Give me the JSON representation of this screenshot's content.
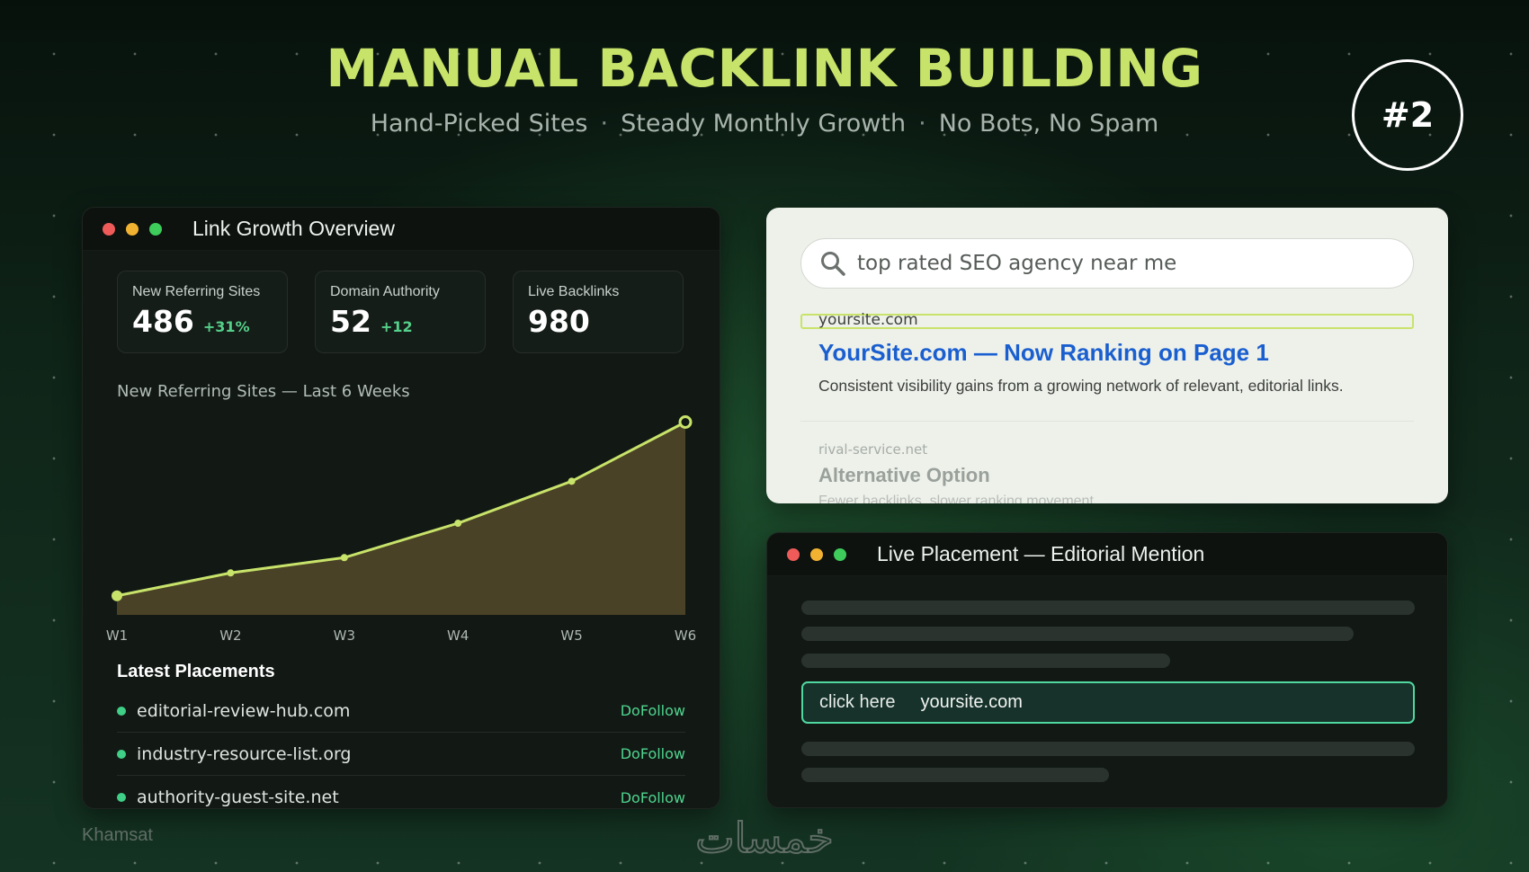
{
  "header": {
    "title": "MANUAL BACKLINK BUILDING",
    "subtitle_items": [
      "Hand-Picked Sites",
      "Steady Monthly Growth",
      "No Bots, No Spam"
    ],
    "separator": "·",
    "badge": "#2"
  },
  "left_panel": {
    "title": "Link Growth Overview",
    "stats": [
      {
        "label": "New Referring Sites",
        "value": "486",
        "delta": "+31%"
      },
      {
        "label": "Domain Authority",
        "value": "52",
        "delta": "+12"
      },
      {
        "label": "Live Backlinks",
        "value": "980",
        "delta": ""
      }
    ],
    "chart_title": "New Referring Sites — Last 6 Weeks",
    "placements_title": "Latest Placements",
    "placements": [
      {
        "domain": "editorial-review-hub.com",
        "tag": "DoFollow"
      },
      {
        "domain": "industry-resource-list.org",
        "tag": "DoFollow"
      },
      {
        "domain": "authority-guest-site.net",
        "tag": "DoFollow"
      }
    ]
  },
  "chart_data": {
    "type": "area",
    "categories": [
      "W1",
      "W2",
      "W3",
      "W4",
      "W5",
      "W6"
    ],
    "values": [
      10,
      22,
      30,
      48,
      70,
      101
    ],
    "ylim": [
      0,
      105
    ],
    "grid": false,
    "colors": {
      "line": "#c8e36a",
      "fill": "#4a4226"
    }
  },
  "search_panel": {
    "query": "top rated SEO agency near me",
    "results": [
      {
        "url": "yoursite.com",
        "title": "YourSite.com — Now Ranking on Page 1",
        "desc": "Consistent visibility gains from a growing network of relevant, editorial links."
      },
      {
        "url": "rival-service.net",
        "title": "Alternative Option",
        "desc": "Fewer backlinks, slower ranking movement ..."
      }
    ]
  },
  "placement_panel": {
    "title": "Live Placement — Editorial Mention",
    "link_label": "click here",
    "link_domain": "yoursite.com"
  },
  "footer": {
    "left_text": "Khamsat",
    "logo_text": "خمسات"
  },
  "colors": {
    "accent": "#c8e36a",
    "link_blue": "#1a5fd0",
    "success": "#4fd48e"
  }
}
